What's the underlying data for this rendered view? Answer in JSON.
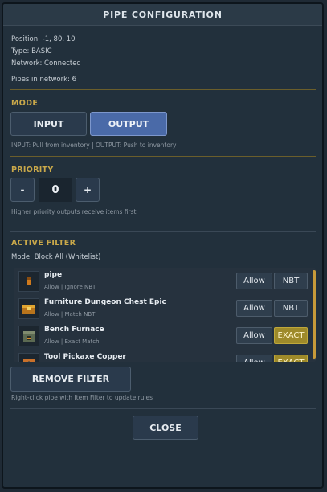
{
  "window": {
    "title": "PIPE CONFIGURATION"
  },
  "info": {
    "position": "Position: -1, 80, 10",
    "type": "Type: BASIC",
    "network": "Network: Connected",
    "pipes": "Pipes in network: 6"
  },
  "mode": {
    "title": "MODE",
    "input_label": "INPUT",
    "output_label": "OUTPUT",
    "selected": "OUTPUT",
    "hint": "INPUT: Pull from inventory | OUTPUT: Push to inventory"
  },
  "priority": {
    "title": "PRIORITY",
    "minus_label": "-",
    "value": "0",
    "plus_label": "+",
    "hint": "Higher priority outputs receive items first"
  },
  "filter": {
    "title": "ACTIVE FILTER",
    "mode_text": "Mode: Block All (Whitelist)",
    "items": [
      {
        "name": "pipe",
        "sub": "Allow | Ignore NBT",
        "action": "Allow",
        "match": "NBT",
        "match_active": false,
        "icon": "pipe-item-icon"
      },
      {
        "name": "Furniture Dungeon Chest Epic",
        "sub": "Allow | Match NBT",
        "action": "Allow",
        "match": "NBT",
        "match_active": false,
        "icon": "chest-item-icon"
      },
      {
        "name": "Bench Furnace",
        "sub": "Allow | Exact Match",
        "action": "Allow",
        "match": "EXACT",
        "match_active": true,
        "icon": "furnace-item-icon"
      },
      {
        "name": "Tool Pickaxe Copper",
        "sub": "",
        "action": "Allow",
        "match": "EXACT",
        "match_active": true,
        "icon": "pickaxe-item-icon"
      }
    ],
    "remove_label": "REMOVE FILTER",
    "hint": "Right-click pipe with Item Filter to update rules"
  },
  "footer": {
    "close_label": "CLOSE"
  },
  "colors": {
    "accent": "#c9a84a",
    "active_button": "#4a6aa8",
    "exact_tag": "#9e8a2a"
  }
}
